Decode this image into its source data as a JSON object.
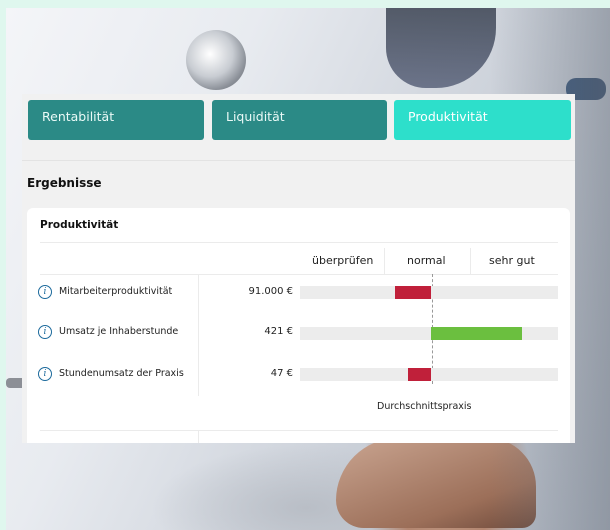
{
  "tabs": [
    {
      "label": "Rentabilität",
      "active": false
    },
    {
      "label": "Liquidität",
      "active": false
    },
    {
      "label": "Produktivität",
      "active": true
    }
  ],
  "section_title": "Ergebnisse",
  "card": {
    "title": "Produktivität",
    "columns": [
      "überprüfen",
      "normal",
      "sehr gut"
    ],
    "rows": [
      {
        "label": "Mitarbeiterproduktivität",
        "value": "91.000 €",
        "deviation": -0.28,
        "status_color": "#c0203a"
      },
      {
        "label": "Umsatz je Inhaberstunde",
        "value": "421 €",
        "deviation": 0.72,
        "status_color": "#6bbf3f"
      },
      {
        "label": "Stundenumsatz der Praxis",
        "value": "47 €",
        "deviation": -0.18,
        "status_color": "#c0203a"
      }
    ],
    "reference_label": "Durchschnittspraxis"
  },
  "icons": {
    "info": "info-icon"
  },
  "colors": {
    "tab": "#2b8a86",
    "tab_active": "#2ddfcb",
    "bad": "#c0203a",
    "good": "#6bbf3f"
  }
}
